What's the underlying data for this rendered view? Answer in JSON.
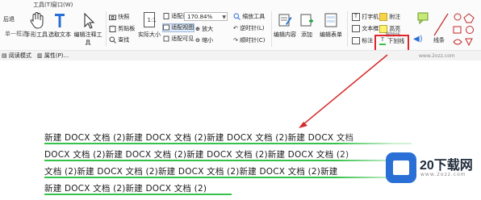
{
  "menu": {
    "items": [
      "工具(T)",
      "窗口(W)"
    ],
    "left_label": "后退"
  },
  "ribbon": {
    "group_left": "单一框选",
    "buttons": {
      "hand_tool": "手形工具",
      "select_text": "选取文本",
      "edit_annot": "编辑注释工具",
      "snapshot": "快照",
      "clipboard": "剪贴板",
      "find": "查找",
      "actual_size": "实际大小",
      "fit_page": "适配页面",
      "fit_width": "适配视图",
      "fit_visible": "适配可见",
      "zoom_in": "放大",
      "zoom_out": "缩小",
      "zoom_tool": "缩放工具",
      "rotate_left": "逆时针(L)",
      "rotate_right": "顺时针(C)",
      "edit_content": "编辑内容",
      "add": "添加",
      "edit_form": "编辑表单",
      "typewriter": "打字机",
      "note": "附注",
      "textbox": "文本框",
      "highlight": "高亮",
      "callout": "标注",
      "underline": "下划线",
      "strikeout": "删除线",
      "line": "线条"
    },
    "zoom_value": "170.84%",
    "sub_left": "阅读模式",
    "sub_second": "属性(P)..."
  },
  "document": {
    "lines": [
      "新建 DOCX 文档 (2)新建 DOCX 文档 (2)新建 DOCX 文档 (2)新建 DOCX 文档",
      "DOCX 文档 (2)新建 DOCX 文档 (2)新建 DOCX 文档 (2)新建 DOCX 文档 (2)",
      "文档 (2)新建 DOCX 文档 (2)新建 DOCX 文档 (2)新建 DOCX 文档 (2)新建",
      "新建 DOCX 文档 (2)新建 DOCX 文档 (2)"
    ]
  },
  "watermark": {
    "brand": "20下载网",
    "sub": "www.2ozz.com"
  },
  "colors": {
    "highlight_box": "#e0262a",
    "arrow": "#d62a2a",
    "underline": "#35c24a",
    "brand_blue": "#2a6fd6"
  }
}
